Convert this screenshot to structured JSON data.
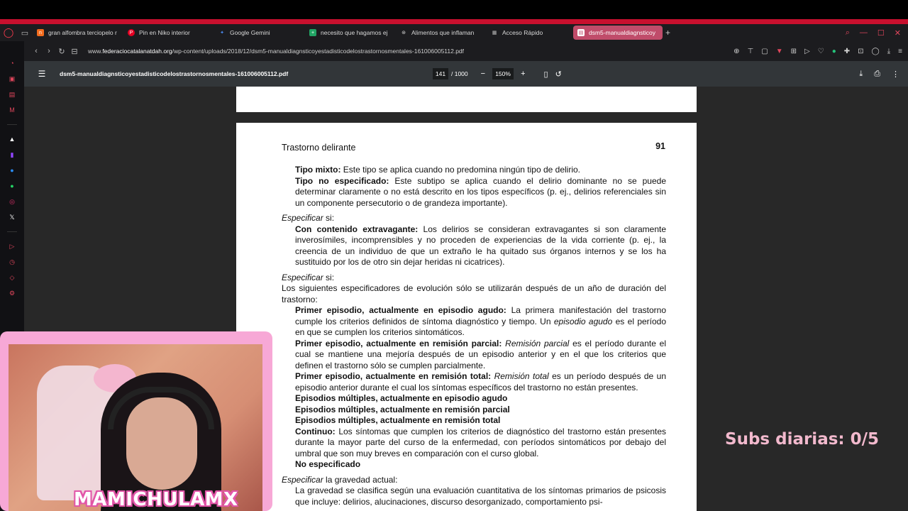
{
  "browser": {
    "tabs": [
      {
        "label": "gran alfombra terciopelo r",
        "icon": "orange-n-icon",
        "color": "#f26b1d"
      },
      {
        "label": "Pin en Niko interior",
        "icon": "pinterest-icon",
        "color": "#e60023"
      },
      {
        "label": "Google Gemini",
        "icon": "gemini-icon",
        "color": "#4c8df6"
      },
      {
        "label": "necesito que hagamos ej",
        "icon": "sheets-icon",
        "color": "#21a464"
      },
      {
        "label": "Alimentos que inflaman",
        "icon": "chatgpt-icon",
        "color": "#d0d0d0"
      },
      {
        "label": "Acceso Rápido",
        "icon": "grid-icon",
        "color": "#bbbbbb"
      },
      {
        "label": "dsm5-manualdiagnsticoy",
        "icon": "doc-icon",
        "color": "#ffffff",
        "active": true
      }
    ],
    "url_prefix": "www.",
    "url_domain": "federaciocatalanatdah.org",
    "url_path": "/wp-content/uploads/2018/12/dsm5-manualdiagnsticoyestadisticodelostrastornosmentales-161006005112.pdf"
  },
  "pdf": {
    "filename": "dsm5-manualdiagnsticoyestadisticodelostrastornosmentales-161006005112.pdf",
    "page": "141",
    "total_pages": "/ 1000",
    "zoom": "150%"
  },
  "page_content": {
    "header": "Trastorno delirante",
    "page_number": "91",
    "l1_b": "Tipo mixto:",
    "l1_t": " Este tipo se aplica cuando no predomina ningún tipo de delirio.",
    "l2_b": "Tipo no especificado:",
    "l2_t": " Este subtipo se aplica cuando el delirio dominante no se puede determinar claramente o no está descrito en los tipos específicos (p. ej., delirios referenciales sin un componente persecutorio o de grandeza importante).",
    "spec1_i": "Especificar",
    "spec1_t": " si:",
    "l3_b": "Con contenido extravagante:",
    "l3_t": " Los delirios se consideran extravagantes si son claramente inverosímiles, incomprensibles y no proceden de experiencias de la vida corriente (p. ej., la creencia de un individuo de que un extraño le ha quitado sus órganos internos y se los ha sustituido por los de otro sin dejar heridas ni cicatrices).",
    "spec2_i": "Especificar",
    "spec2_t": " si:",
    "spec2_body": "Los siguientes especificadores de evolución sólo se utilizarán después de un año de duración del trastorno:",
    "l4_b": "Primer episodio, actualmente en episodio agudo:",
    "l4_t1": " La primera manifestación del trastorno cumple los criterios definidos de síntoma diagnóstico y tiempo. Un ",
    "l4_i": "episodio agudo",
    "l4_t2": " es el período en que se cumplen los criterios sintomáticos.",
    "l5_b": "Primer episodio, actualmente en remisión parcial:",
    "l5_i": " Remisión parcial",
    "l5_t": " es el período durante el cual se mantiene una mejoría después de un episodio anterior y en el que los criterios que definen el trastorno sólo se cumplen parcialmente.",
    "l6_b": "Primer episodio, actualmente en remisión total:",
    "l6_i": " Remisión total",
    "l6_t": " es un período después de un episodio anterior durante el cual los síntomas específicos del trastorno no están presentes.",
    "l7_b": "Episodios múltiples, actualmente en episodio agudo",
    "l8_b": "Episodios múltiples, actualmente en remisión parcial",
    "l9_b": "Episodios múltiples, actualmente en remisión total",
    "l10_b": "Continuo:",
    "l10_t": " Los síntomas que cumplen los criterios de diagnóstico del trastorno están presentes durante la mayor parte del curso de la enfermedad, con períodos sintomáticos por debajo del umbral que son muy breves en comparación con el curso global.",
    "l11_b": "No especificado",
    "spec3_i": "Especificar",
    "spec3_t": " la gravedad actual:",
    "l12_t": "La gravedad se clasifica según una evaluación cuantitativa de los síntomas primarios de psicosis que incluye: delirios, alucinaciones, discurso desorganizado, comportamiento psi-"
  },
  "overlay": {
    "streamer_name": "MAMICHULAMX",
    "subs_text": "Subs diarias: 0/5"
  }
}
